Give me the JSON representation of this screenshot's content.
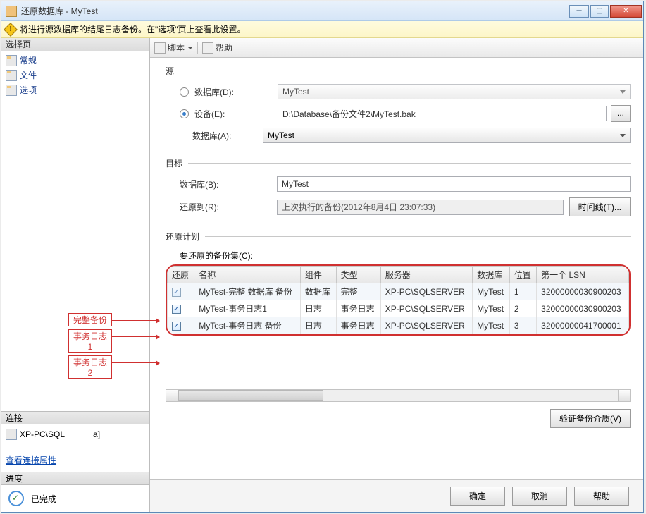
{
  "window": {
    "title": "还原数据库 - MyTest"
  },
  "info_message": "将进行源数据库的结尾日志备份。在\"选项\"页上查看此设置。",
  "leftpane": {
    "select_header": "选择页",
    "items": [
      {
        "label": "常规"
      },
      {
        "label": "文件"
      },
      {
        "label": "选项"
      }
    ],
    "connection_header": "连接",
    "connection_text": "XP-PC\\SQL",
    "connection_suffix": "a]",
    "view_link": "查看连接属性",
    "progress_header": "进度",
    "progress_text": "已完成"
  },
  "callouts": [
    "完整备份",
    "事务日志1",
    "事务日志2"
  ],
  "toolbar": {
    "script": "脚本",
    "help": "帮助"
  },
  "groups": {
    "source": "源",
    "target": "目标",
    "plan": "还原计划"
  },
  "source": {
    "db_label": "数据库(D):",
    "db_value": "MyTest",
    "device_label": "设备(E):",
    "device_value": "D:\\Database\\备份文件2\\MyTest.bak",
    "browse": "...",
    "dba_label": "数据库(A):",
    "dba_value": "MyTest"
  },
  "target": {
    "db_label": "数据库(B):",
    "db_value": "MyTest",
    "restore_to_label": "还原到(R):",
    "restore_to_value": "上次执行的备份(2012年8月4日 23:07:33)",
    "timeline": "时间线(T)..."
  },
  "plan": {
    "sets_label": "要还原的备份集(C):",
    "columns": [
      "还原",
      "名称",
      "组件",
      "类型",
      "服务器",
      "数据库",
      "位置",
      "第一个 LSN"
    ],
    "rows": [
      {
        "name": "MyTest-完整 数据库 备份",
        "component": "数据库",
        "type": "完整",
        "server": "XP-PC\\SQLSERVER",
        "db": "MyTest",
        "pos": "1",
        "lsn": "32000000030900203"
      },
      {
        "name": "MyTest-事务日志1",
        "component": "日志",
        "type": "事务日志",
        "server": "XP-PC\\SQLSERVER",
        "db": "MyTest",
        "pos": "2",
        "lsn": "32000000030900203"
      },
      {
        "name": "MyTest-事务日志  备份",
        "component": "日志",
        "type": "事务日志",
        "server": "XP-PC\\SQLSERVER",
        "db": "MyTest",
        "pos": "3",
        "lsn": "32000000041700001"
      }
    ],
    "verify": "验证备份介质(V)"
  },
  "footer": {
    "ok": "确定",
    "cancel": "取消",
    "help": "帮助"
  }
}
